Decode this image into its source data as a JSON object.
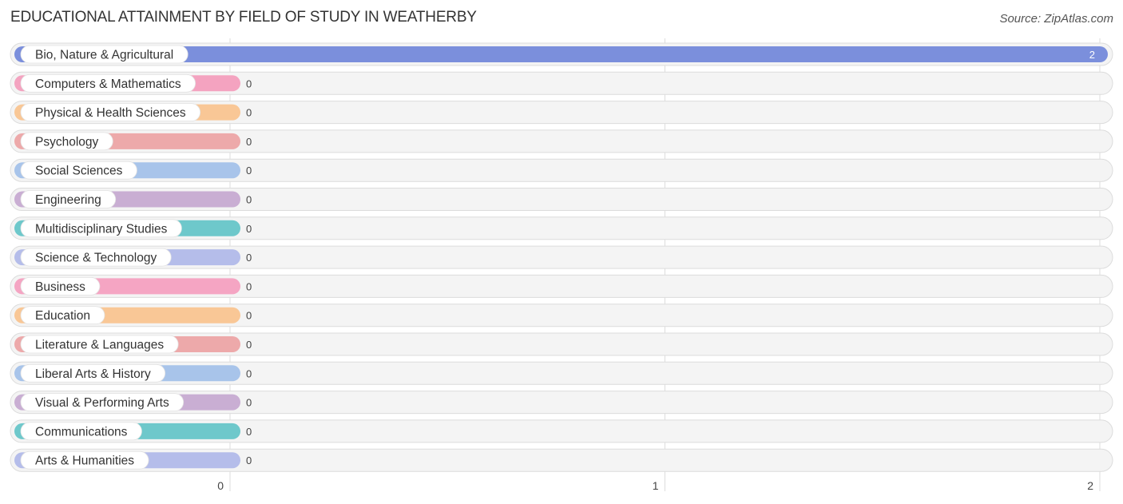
{
  "title": "EDUCATIONAL ATTAINMENT BY FIELD OF STUDY IN WEATHERBY",
  "source": "Source: ZipAtlas.com",
  "chart_data": {
    "type": "bar",
    "orientation": "horizontal",
    "title": "EDUCATIONAL ATTAINMENT BY FIELD OF STUDY IN WEATHERBY",
    "xlabel": "",
    "ylabel": "",
    "xlim": [
      0,
      2
    ],
    "x_ticks": [
      "0",
      "1",
      "2"
    ],
    "grid": true,
    "categories": [
      "Bio, Nature & Agricultural",
      "Computers & Mathematics",
      "Physical & Health Sciences",
      "Psychology",
      "Social Sciences",
      "Engineering",
      "Multidisciplinary Studies",
      "Science & Technology",
      "Business",
      "Education",
      "Literature & Languages",
      "Liberal Arts & History",
      "Visual & Performing Arts",
      "Communications",
      "Arts & Humanities"
    ],
    "values": [
      2,
      0,
      0,
      0,
      0,
      0,
      0,
      0,
      0,
      0,
      0,
      0,
      0,
      0,
      0
    ],
    "colors": [
      "#7b8fdc",
      "#f4a3c0",
      "#f9c796",
      "#eda9aa",
      "#a8c4ea",
      "#c9aed3",
      "#6ec8cb",
      "#b5bdea",
      "#f5a5c3",
      "#f9c796",
      "#eda9aa",
      "#a8c4ea",
      "#c9aed3",
      "#6ec8cb",
      "#b5bdea"
    ]
  }
}
